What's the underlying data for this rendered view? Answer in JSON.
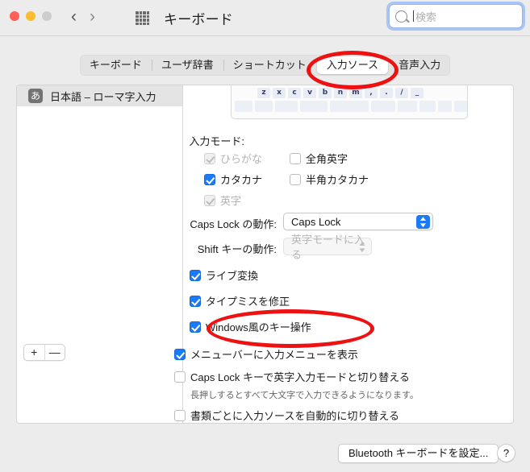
{
  "window": {
    "title": "キーボード",
    "traffic_lights": [
      "close",
      "minimize",
      "zoom"
    ],
    "back_arrow": "‹",
    "forward_arrow": "›",
    "grid_icon": "grid-icon"
  },
  "search": {
    "placeholder": "検索",
    "value": "",
    "icon": "search-icon"
  },
  "tabs": [
    {
      "label": "キーボード",
      "selected": false
    },
    {
      "label": "ユーザ辞書",
      "selected": false
    },
    {
      "label": "ショートカット",
      "selected": false
    },
    {
      "label": "入力ソース",
      "selected": true
    },
    {
      "label": "音声入力",
      "selected": false
    }
  ],
  "sidebar": {
    "items": [
      {
        "badge": "あ",
        "label": "日本語 – ローマ字入力",
        "selected": true
      }
    ],
    "add_label": "+",
    "remove_label": "—"
  },
  "keyboard_preview": {
    "row_keys": [
      "z",
      "x",
      "c",
      "v",
      "b",
      "n",
      "m",
      ",",
      ".",
      "/",
      "_"
    ]
  },
  "detail": {
    "input_mode_label": "入力モード:",
    "input_modes": [
      {
        "label": "ひらがな",
        "checked": true,
        "disabled": true
      },
      {
        "label": "全角英字",
        "checked": false,
        "disabled": false
      },
      {
        "label": "カタカナ",
        "checked": true,
        "disabled": false
      },
      {
        "label": "半角カタカナ",
        "checked": false,
        "disabled": false
      },
      {
        "label": "英字",
        "checked": true,
        "disabled": true
      }
    ],
    "caps_lock_label": "Caps Lock の動作:",
    "caps_lock_value": "Caps Lock",
    "shift_key_label": "Shift キーの動作:",
    "shift_key_value": "英字モードに入る",
    "options": [
      {
        "label": "ライブ変換",
        "checked": true
      },
      {
        "label": "タイプミスを修正",
        "checked": true
      },
      {
        "label": "Windows風のキー操作",
        "checked": true
      }
    ]
  },
  "bottom_options": [
    {
      "label": "メニューバーに入力メニューを表示",
      "checked": true
    },
    {
      "label": "Caps Lock キーで英字入力モードと切り替える",
      "checked": false,
      "hint": "長押しするとすべて大文字で入力できるようになります。"
    },
    {
      "label": "書類ごとに入力ソースを自動的に切り替える",
      "checked": false
    }
  ],
  "footer": {
    "bluetooth_button": "Bluetooth キーボードを設定...",
    "help_button": "?"
  },
  "annotations": {
    "accent_color": "#ee1111",
    "highlighted_tab": "入力ソース",
    "highlighted_option": "Windows風のキー操作"
  }
}
